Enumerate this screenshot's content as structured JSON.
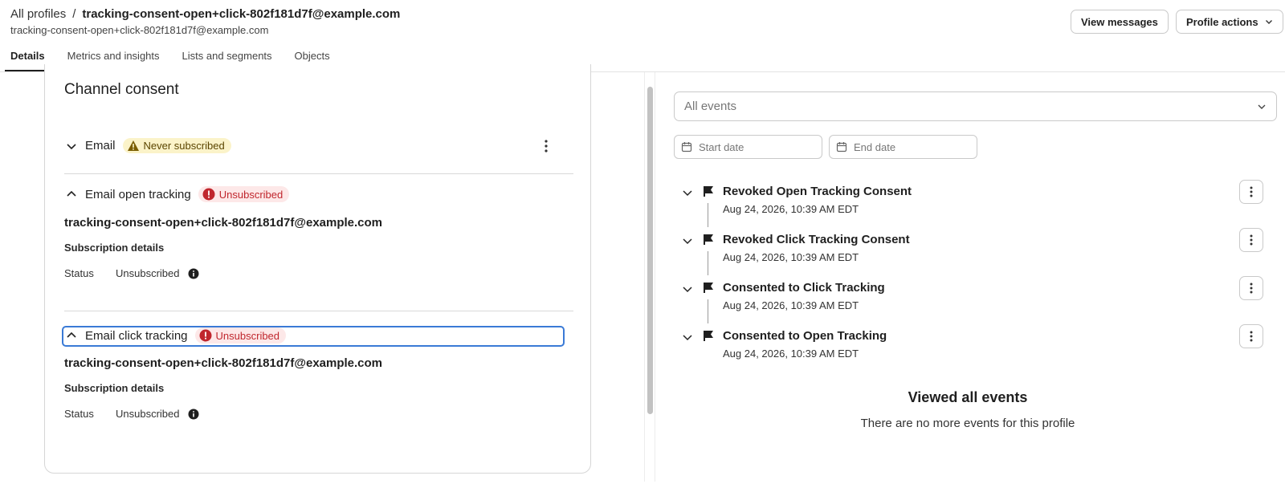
{
  "header": {
    "breadcrumb_link": "All profiles",
    "breadcrumb_sep": "/",
    "profile_title": "tracking-consent-open+click-802f181d7f@example.com",
    "profile_subtitle": "tracking-consent-open+click-802f181d7f@example.com",
    "view_messages": "View messages",
    "profile_actions": "Profile actions"
  },
  "tabs": [
    {
      "label": "Details",
      "active": true
    },
    {
      "label": "Metrics and insights"
    },
    {
      "label": "Lists and segments"
    },
    {
      "label": "Objects"
    }
  ],
  "consent": {
    "title": "Channel consent",
    "email": {
      "label": "Email",
      "badge": "Never subscribed"
    },
    "open_tracking": {
      "label": "Email open tracking",
      "badge": "Unsubscribed",
      "address": "tracking-consent-open+click-802f181d7f@example.com",
      "details_heading": "Subscription details",
      "status_label": "Status",
      "status_value": "Unsubscribed"
    },
    "click_tracking": {
      "label": "Email click tracking",
      "badge": "Unsubscribed",
      "address": "tracking-consent-open+click-802f181d7f@example.com",
      "details_heading": "Subscription details",
      "status_label": "Status",
      "status_value": "Unsubscribed"
    }
  },
  "events_panel": {
    "filter_value": "All events",
    "start_date_placeholder": "Start date",
    "end_date_placeholder": "End date",
    "events": [
      {
        "name": "Revoked Open Tracking Consent",
        "time": "Aug 24, 2026, 10:39 AM EDT"
      },
      {
        "name": "Revoked Click Tracking Consent",
        "time": "Aug 24, 2026, 10:39 AM EDT"
      },
      {
        "name": "Consented to Click Tracking",
        "time": "Aug 24, 2026, 10:39 AM EDT"
      },
      {
        "name": "Consented to Open Tracking",
        "time": "Aug 24, 2026, 10:39 AM EDT"
      }
    ],
    "end_title": "Viewed all events",
    "end_subtitle": "There are no more events for this profile"
  },
  "colors": {
    "warn_bg": "#fbf3c9",
    "error": "#c0262d",
    "error_bg": "#fde8e8",
    "focus": "#3a7ad6"
  }
}
